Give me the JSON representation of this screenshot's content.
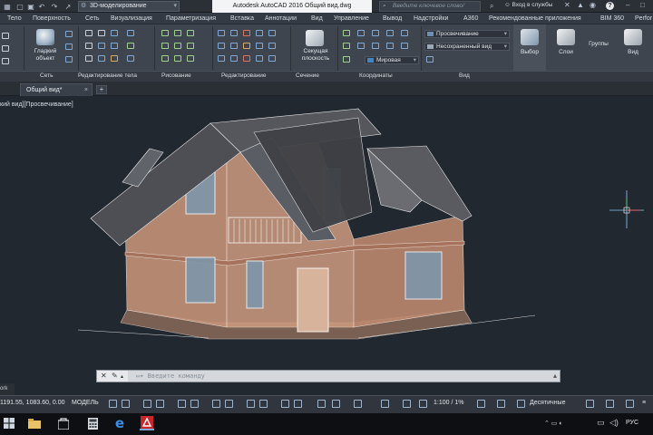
{
  "titlebar": {
    "workspace": "3D-моделирование",
    "app_title": "Autodesk AutoCAD 2016    Общий вид.dwg",
    "search_placeholder": "Введите ключевое слово/фразу",
    "sign_in": "Вход в службы"
  },
  "ribbon_tabs": [
    "Тело",
    "Поверхность",
    "Сеть",
    "Визуализация",
    "Параметризация",
    "Вставка",
    "Аннотации",
    "Вид",
    "Управление",
    "Вывод",
    "Надстройки",
    "A360",
    "Рекомендованные приложения",
    "BIM 360",
    "Perfor"
  ],
  "ribbon": {
    "smooth_object_label": "Гладкий объект",
    "section_plane_label": "Секущая плоскость",
    "visual_style": "Просвечивание",
    "view_saved": "Несохраненный вид",
    "coord_system": "Мировая",
    "select_label": "Выбор",
    "layers_label": "Слои",
    "groups_label": "Группы",
    "view_label": "Вид",
    "panels": {
      "mesh": "Сеть",
      "solid_edit": "Редактирование тела",
      "draw": "Рисование",
      "modify": "Редактирование",
      "section": "Сечение",
      "coordinates": "Координаты",
      "view": "Вид"
    }
  },
  "doc_tab": {
    "label": "Общий вид*"
  },
  "viewport": {
    "label": "кий вид][Просвечивание]"
  },
  "command": {
    "placeholder": "Введите команду"
  },
  "model_tab": "ork",
  "status": {
    "coords": "1191.55, 1083.60, 0.00",
    "model": "МОДЕЛЬ",
    "scale": "1:100 / 1%",
    "units": "Десятичные"
  },
  "tray": {
    "lang": "РУС"
  },
  "colors": {
    "wall": "#c9957b",
    "roof": "#4d4f55",
    "viewport_bg": "#212830",
    "accent": "#7aa7d8"
  }
}
